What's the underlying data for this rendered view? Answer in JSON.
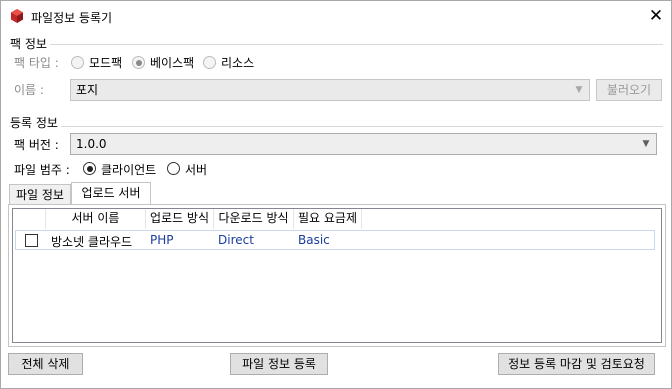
{
  "window": {
    "title": "파일정보 등록기",
    "close_icon": "close-icon"
  },
  "pack_info": {
    "group_title": "팩 정보",
    "type_label": "팩 타입 :",
    "types": [
      {
        "label": "모드팩",
        "checked": false
      },
      {
        "label": "베이스팩",
        "checked": true
      },
      {
        "label": "리소스",
        "checked": false
      }
    ],
    "name_label": "이름 :",
    "name_value": "포지",
    "load_button": "불러오기"
  },
  "registration": {
    "group_title": "등록 정보",
    "version_label": "팩 버전 :",
    "version_value": "1.0.0",
    "category_label": "파일 범주 :",
    "categories": [
      {
        "label": "클라이언트",
        "checked": true
      },
      {
        "label": "서버",
        "checked": false
      }
    ]
  },
  "tabs": [
    {
      "label": "파일 정보",
      "active": false
    },
    {
      "label": "업로드 서버",
      "active": true
    }
  ],
  "server_table": {
    "columns": [
      "",
      "서버 이름",
      "업로드 방식",
      "다운로드 방식",
      "필요 요금제"
    ],
    "rows": [
      {
        "checked": false,
        "server_name": "방소넷 클라우드",
        "upload": "PHP",
        "download": "Direct",
        "plan": "Basic"
      }
    ]
  },
  "footer": {
    "delete_all": "전체 삭제",
    "register_file_info": "파일 정보 등록",
    "finish_and_review": "정보 등록 마감 및 검토요청"
  }
}
